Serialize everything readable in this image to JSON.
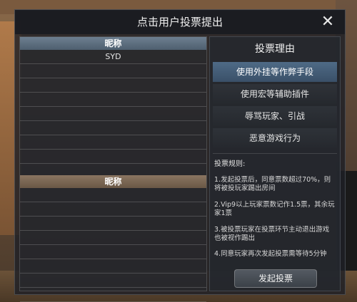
{
  "dialog": {
    "title": "点击用户投票提出",
    "close_symbol": "✕"
  },
  "player_list": {
    "team1_header": "昵称",
    "team2_header": "昵称",
    "team1_rows": [
      "SYD",
      "",
      "",
      "",
      "",
      "",
      "",
      "",
      ""
    ],
    "team2_rows": [
      "",
      "",
      "",
      "",
      "",
      "",
      "",
      ""
    ]
  },
  "reason_panel": {
    "title": "投票理由",
    "reasons": [
      "使用外挂等作弊手段",
      "使用宏等辅助插件",
      "辱骂玩家、引战",
      "恶意游戏行为"
    ],
    "selected_index": 0,
    "rules_title": "投票规则:",
    "rules": [
      "1.发起投票后，同意票数超过70%，则将被投玩家踢出房间",
      "2.Vip9以上玩家票数记作1.5票，其余玩家1票",
      "3.被投票玩家在投票环节主动退出游戏也被视作踢出",
      "4.同意玩家再次发起投票需等待5分钟"
    ],
    "submit_label": "发起投票"
  },
  "colors": {
    "selected_reason": "#4e6a86",
    "team1_header": "#5e6f80",
    "team2_header": "#7a6653"
  }
}
